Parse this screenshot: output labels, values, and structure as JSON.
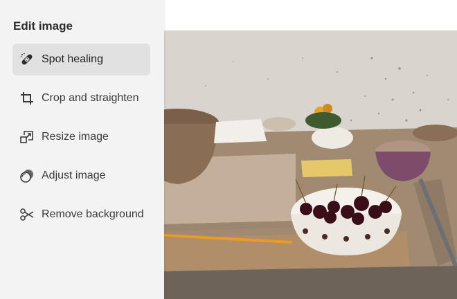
{
  "panel": {
    "title": "Edit image",
    "items": [
      {
        "label": "Spot healing",
        "icon": "spot-healing-icon",
        "selected": true
      },
      {
        "label": "Crop and straighten",
        "icon": "crop-icon",
        "selected": false
      },
      {
        "label": "Resize image",
        "icon": "resize-icon",
        "selected": false
      },
      {
        "label": "Adjust image",
        "icon": "adjust-icon",
        "selected": false
      },
      {
        "label": "Remove background",
        "icon": "scissors-icon",
        "selected": false
      }
    ]
  },
  "colors": {
    "sidebar_bg": "#f3f3f3",
    "selected_item_bg": "#e1e1e1",
    "text": "#2c2c2c"
  }
}
